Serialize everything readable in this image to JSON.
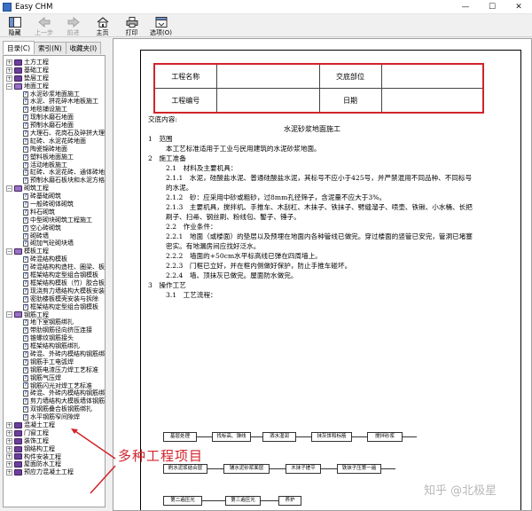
{
  "window": {
    "title": "Easy CHM",
    "minimize": "—",
    "maximize": "☐",
    "close": "✕"
  },
  "toolbar": {
    "buttons": [
      {
        "label": "隐藏",
        "icon": "hide-icon",
        "enabled": true
      },
      {
        "label": "上一步",
        "icon": "back-icon",
        "enabled": false
      },
      {
        "label": "前进",
        "icon": "forward-icon",
        "enabled": false
      },
      {
        "label": "主页",
        "icon": "home-icon",
        "enabled": true
      },
      {
        "label": "打印",
        "icon": "print-icon",
        "enabled": true
      },
      {
        "label": "选项(O)",
        "icon": "options-icon",
        "enabled": true
      }
    ]
  },
  "nav_tabs": {
    "contents": "目录(C)",
    "index": "索引(N)",
    "favorites": "收藏夹(I)"
  },
  "tree": [
    {
      "level": 0,
      "type": "book",
      "expanded": false,
      "label": "土方工程"
    },
    {
      "level": 0,
      "type": "book",
      "expanded": false,
      "label": "基础工程"
    },
    {
      "level": 0,
      "type": "book",
      "expanded": false,
      "label": "垫层工程"
    },
    {
      "level": 0,
      "type": "book",
      "expanded": true,
      "label": "地面工程"
    },
    {
      "level": 1,
      "type": "page",
      "label": "水泥砂浆地面施工"
    },
    {
      "level": 1,
      "type": "page",
      "label": "水泥、拼花碎木地板施工"
    },
    {
      "level": 1,
      "type": "page",
      "label": "地毯铺设施工"
    },
    {
      "level": 1,
      "type": "page",
      "label": "现制水磨石地面"
    },
    {
      "level": 1,
      "type": "page",
      "label": "预制水磨石地面"
    },
    {
      "level": 1,
      "type": "page",
      "label": "大理石、花岗石及碎拼大理石"
    },
    {
      "level": 1,
      "type": "page",
      "label": "缸砖、水泥花砖地面"
    },
    {
      "level": 1,
      "type": "page",
      "label": "陶瓷锦砖地面"
    },
    {
      "level": 1,
      "type": "page",
      "label": "塑料板地面施工"
    },
    {
      "level": 1,
      "type": "page",
      "label": "活动地板施工"
    },
    {
      "level": 1,
      "type": "page",
      "label": "缸砖、水泥花砖、通体砖地"
    },
    {
      "level": 1,
      "type": "page",
      "label": "预制水磨石板块和水泥方格砖"
    },
    {
      "level": 0,
      "type": "book",
      "expanded": true,
      "label": "砌筑工程"
    },
    {
      "level": 1,
      "type": "page",
      "label": "砖基础砌筑"
    },
    {
      "level": 1,
      "type": "page",
      "label": "一般砖砌体砌筑"
    },
    {
      "level": 1,
      "type": "page",
      "label": "料石砌筑"
    },
    {
      "level": 1,
      "type": "page",
      "label": "中型砌块砌筑工程施工"
    },
    {
      "level": 1,
      "type": "page",
      "label": "空心砖砌筑"
    },
    {
      "level": 1,
      "type": "page",
      "label": "砌砖墙"
    },
    {
      "level": 1,
      "type": "page",
      "label": "砌加气砼砌块墙"
    },
    {
      "level": 0,
      "type": "book",
      "expanded": true,
      "label": "模板工程"
    },
    {
      "level": 1,
      "type": "page",
      "label": "砖混结构模板"
    },
    {
      "level": 1,
      "type": "page",
      "label": "砖混结构构造柱、圈梁、板"
    },
    {
      "level": 1,
      "type": "page",
      "label": "框架结构定型组合钢模板"
    },
    {
      "level": 1,
      "type": "page",
      "label": "框架结构模板（竹）胶合板模"
    },
    {
      "level": 1,
      "type": "page",
      "label": "现浇剪力墙结构大模板安装"
    },
    {
      "level": 1,
      "type": "page",
      "label": "密肋楼板模壳安装与拆除"
    },
    {
      "level": 1,
      "type": "page",
      "label": "框架结构定型组合钢模板"
    },
    {
      "level": 0,
      "type": "book",
      "expanded": true,
      "label": "钢筋工程"
    },
    {
      "level": 1,
      "type": "page",
      "label": "地下室钢筋绑扎"
    },
    {
      "level": 1,
      "type": "page",
      "label": "带肋钢筋径向挤压连接"
    },
    {
      "level": 1,
      "type": "page",
      "label": "锥螺纹钢筋接头"
    },
    {
      "level": 1,
      "type": "page",
      "label": "框架结构钢筋绑扎"
    },
    {
      "level": 1,
      "type": "page",
      "label": "砖混、外砖内模结构钢筋绑"
    },
    {
      "level": 1,
      "type": "page",
      "label": "钢筋手工电弧焊"
    },
    {
      "level": 1,
      "type": "page",
      "label": "钢筋电渣压力焊工艺标准"
    },
    {
      "level": 1,
      "type": "page",
      "label": "钢筋气压焊"
    },
    {
      "level": 1,
      "type": "page",
      "label": "钢筋闪光对焊工艺标准"
    },
    {
      "level": 1,
      "type": "page",
      "label": "砖混、外砖内模结构钢筋绑"
    },
    {
      "level": 1,
      "type": "page",
      "label": "剪力墙结构大模板墙体钢筋"
    },
    {
      "level": 1,
      "type": "page",
      "label": "双钢筋叠合板钢筋绑扎"
    },
    {
      "level": 1,
      "type": "page",
      "label": "水平钢筋窄间隙焊"
    },
    {
      "level": 0,
      "type": "book",
      "expanded": false,
      "label": "混凝土工程"
    },
    {
      "level": 0,
      "type": "book",
      "expanded": false,
      "label": "门窗工程"
    },
    {
      "level": 0,
      "type": "book",
      "expanded": false,
      "label": "装饰工程"
    },
    {
      "level": 0,
      "type": "book",
      "expanded": false,
      "label": "钢结构工程"
    },
    {
      "level": 0,
      "type": "book",
      "expanded": false,
      "label": "构件安装工程"
    },
    {
      "level": 0,
      "type": "book",
      "expanded": false,
      "label": "屋面防水工程"
    },
    {
      "level": 0,
      "type": "book",
      "expanded": false,
      "label": "预应力混凝土工程"
    }
  ],
  "document": {
    "table": {
      "project_name_label": "工程名称",
      "project_name_value": "",
      "handover_label": "交底部位",
      "handover_value": "",
      "project_no_label": "工程编号",
      "project_no_value": "",
      "date_label": "日期",
      "date_value": ""
    },
    "content_label": "交底内容:",
    "title": "水泥砂浆地面施工",
    "sections": [
      {
        "cls": "h1",
        "text": "1　范围"
      },
      {
        "cls": "ind1",
        "text": "本工艺标准适用于工业与民用建筑的水泥砂浆地面。"
      },
      {
        "cls": "h1",
        "text": "2　施工准备"
      },
      {
        "cls": "ind1",
        "text": "2.1　材料及主要机具："
      },
      {
        "cls": "ind2",
        "text": "2.1.1　水泥，硅酸盐水泥、普通硅酸盐水泥，其标号不应小于425号，并严禁混用不同品种、不同标号的水泥。"
      },
      {
        "cls": "ind2",
        "text": "2.1.2　砂：应采用中砂或粗砂，过8mm孔径筛子，含泥量不应大于3%。"
      },
      {
        "cls": "ind2",
        "text": "2.1.3　主要机具，搅拌机、手推车、木刮杠、木抹子、铁抹子、劈缝溜子、喷壶、铁锹、小水桶、长把刷子、扫帚、钢丝刷、粉线包、錾子、锤子。"
      },
      {
        "cls": "ind1",
        "text": "2.2　作业条件："
      },
      {
        "cls": "ind2",
        "text": "2.2.1　地面（或楼面）的垫层以及预埋在地面内各种管线已做完。穿过楼面的竖管已安完，管洞已堵塞密实。有地漏房间应找好泛水。"
      },
      {
        "cls": "ind2",
        "text": "2.2.2　墙面的+50cm水平标高线已弹在四周墙上。"
      },
      {
        "cls": "ind2",
        "text": "2.2.3　门框已立好，并在框内侧做好保护，防止手推车碰坏。"
      },
      {
        "cls": "ind2",
        "text": "2.2.4　墙、顶抹灰已做完。屋面防水做完。"
      },
      {
        "cls": "h1",
        "text": "3　操作工艺"
      },
      {
        "cls": "ind1",
        "text": "3.1　工艺流程："
      }
    ],
    "flow": [
      [
        "基层处理",
        "找标高、弹线",
        "洒水湿润",
        "抹灰饼和标筋",
        "搅拌砂浆"
      ],
      [
        "刷水泥浆结合层",
        "铺水泥砂浆面层",
        "木抹子搓平",
        "铁抹子压第一遍"
      ],
      [
        "第二遍压光",
        "第三遍压光",
        "养护"
      ]
    ]
  },
  "annotation": {
    "text": "多种工程项目",
    "color": "#d2232a"
  },
  "watermark": "知乎 @北极星"
}
